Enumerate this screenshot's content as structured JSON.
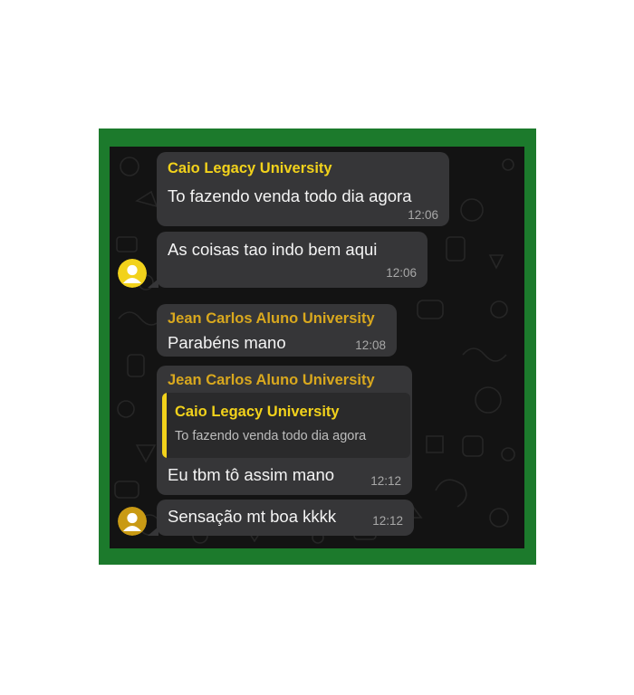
{
  "colors": {
    "frame_border": "#1c7a2c",
    "chat_background": "#131313",
    "bubble": "#363638",
    "sender_caio": "#f2d21b",
    "sender_jean": "#d9a81e",
    "avatar_user_1": "#f2d21b",
    "avatar_user_2": "#c99a14"
  },
  "messages": [
    {
      "sender": "Caio Legacy University",
      "text": "To fazendo venda todo dia agora",
      "time": "12:06"
    },
    {
      "text": "As coisas tao indo bem aqui",
      "time": "12:06",
      "avatar": "user-avatar-icon"
    },
    {
      "sender": "Jean Carlos Aluno University",
      "text": "Parabéns mano",
      "time": "12:08"
    },
    {
      "sender": "Jean Carlos Aluno University",
      "quote": {
        "sender": "Caio Legacy University",
        "text": "To fazendo venda todo dia agora"
      },
      "text": "Eu tbm tô assim mano",
      "time": "12:12"
    },
    {
      "text": "Sensação mt boa kkkk",
      "time": "12:12",
      "avatar": "user-avatar-icon"
    }
  ]
}
